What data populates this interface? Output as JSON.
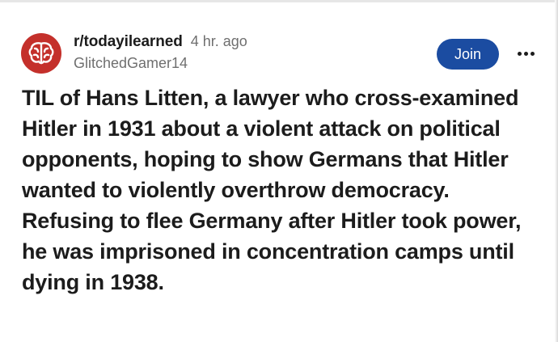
{
  "post": {
    "subreddit": "r/todayilearned",
    "time_ago": "4 hr. ago",
    "username": "GlitchedGamer14",
    "join_label": "Join",
    "title": "TIL of Hans Litten, a lawyer who cross-examined Hitler in 1931 about a violent attack on political opponents, hoping to show Germans that Hitler wanted to violently overthrow democracy. Refusing to flee Germany after Hitler took power, he was imprisoned in concentration camps until dying in 1938."
  },
  "icons": {
    "avatar": "brain-icon",
    "more": "more-options-icon"
  },
  "colors": {
    "avatar_bg": "#c4302b",
    "join_bg": "#1b4ca1",
    "text": "#1c1c1c",
    "muted": "#6f6f6f"
  }
}
